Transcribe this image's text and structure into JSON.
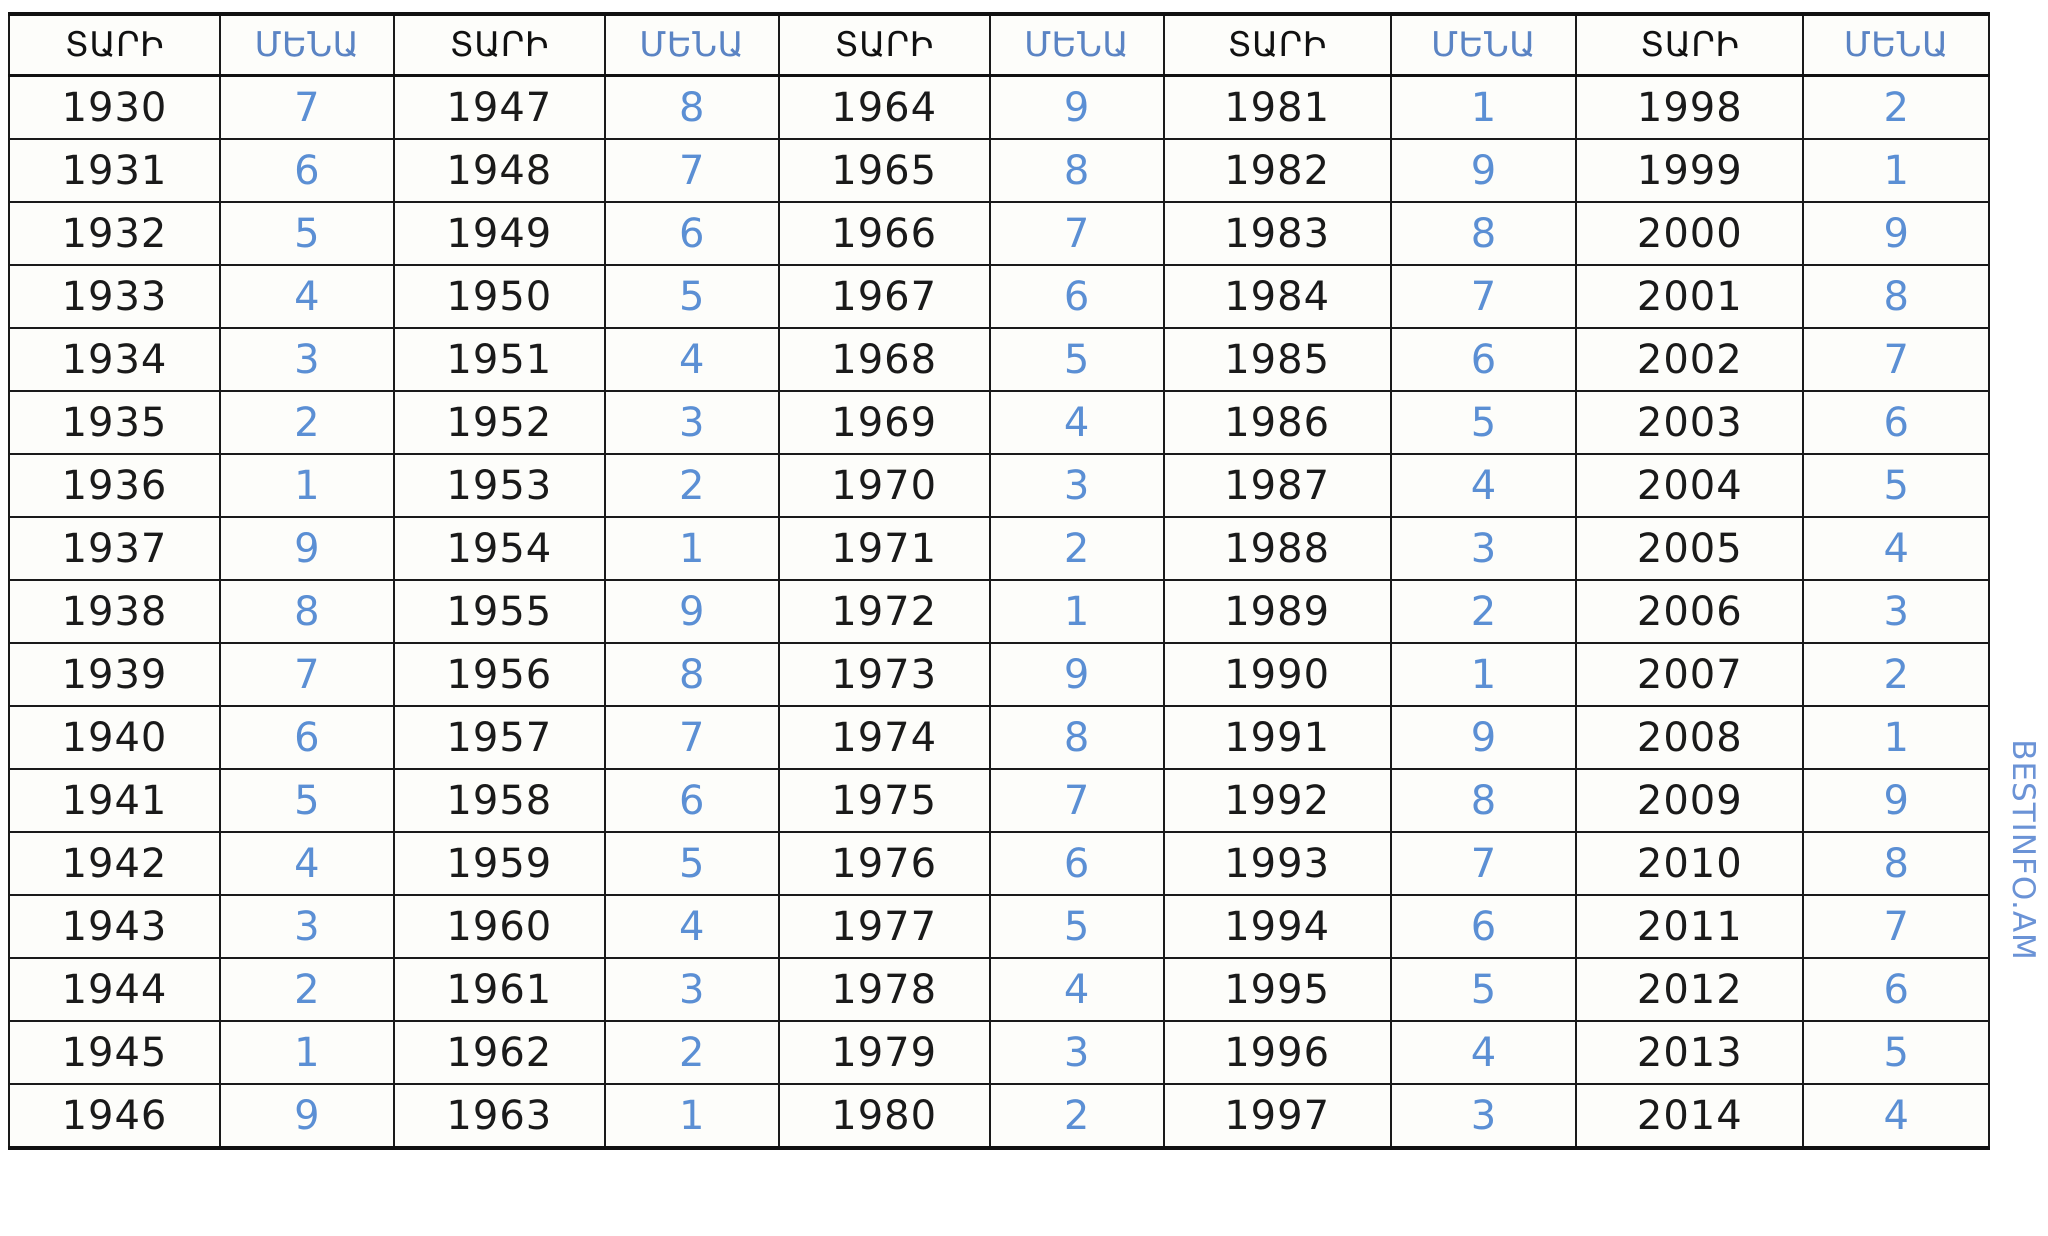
{
  "table": {
    "headers": {
      "year": "ՏԱՐԻ",
      "value": "ՄԵՆԱ"
    },
    "column_headers": [
      "ՏԱՐԻ",
      "ՄԵՆԱ",
      "ՏԱՐԻ",
      "ՄԵՆԱ",
      "ՏԱՐԻ",
      "ՄԵՆԱ",
      "ՏԱՐԻ",
      "ՄԵՆԱ",
      "ՏԱՐԻ",
      "ՄԵՆԱ"
    ],
    "colors": {
      "year_text": "#1a1a1a",
      "value_text": "#5b8fd4",
      "header_value_text": "#5b84c4",
      "border": "#1a1a1a",
      "background": "#fdfdfa"
    },
    "rows": [
      [
        "1930",
        "7",
        "1947",
        "8",
        "1964",
        "9",
        "1981",
        "1",
        "1998",
        "2"
      ],
      [
        "1931",
        "6",
        "1948",
        "7",
        "1965",
        "8",
        "1982",
        "9",
        "1999",
        "1"
      ],
      [
        "1932",
        "5",
        "1949",
        "6",
        "1966",
        "7",
        "1983",
        "8",
        "2000",
        "9"
      ],
      [
        "1933",
        "4",
        "1950",
        "5",
        "1967",
        "6",
        "1984",
        "7",
        "2001",
        "8"
      ],
      [
        "1934",
        "3",
        "1951",
        "4",
        "1968",
        "5",
        "1985",
        "6",
        "2002",
        "7"
      ],
      [
        "1935",
        "2",
        "1952",
        "3",
        "1969",
        "4",
        "1986",
        "5",
        "2003",
        "6"
      ],
      [
        "1936",
        "1",
        "1953",
        "2",
        "1970",
        "3",
        "1987",
        "4",
        "2004",
        "5"
      ],
      [
        "1937",
        "9",
        "1954",
        "1",
        "1971",
        "2",
        "1988",
        "3",
        "2005",
        "4"
      ],
      [
        "1938",
        "8",
        "1955",
        "9",
        "1972",
        "1",
        "1989",
        "2",
        "2006",
        "3"
      ],
      [
        "1939",
        "7",
        "1956",
        "8",
        "1973",
        "9",
        "1990",
        "1",
        "2007",
        "2"
      ],
      [
        "1940",
        "6",
        "1957",
        "7",
        "1974",
        "8",
        "1991",
        "9",
        "2008",
        "1"
      ],
      [
        "1941",
        "5",
        "1958",
        "6",
        "1975",
        "7",
        "1992",
        "8",
        "2009",
        "9"
      ],
      [
        "1942",
        "4",
        "1959",
        "5",
        "1976",
        "6",
        "1993",
        "7",
        "2010",
        "8"
      ],
      [
        "1943",
        "3",
        "1960",
        "4",
        "1977",
        "5",
        "1994",
        "6",
        "2011",
        "7"
      ],
      [
        "1944",
        "2",
        "1961",
        "3",
        "1978",
        "4",
        "1995",
        "5",
        "2012",
        "6"
      ],
      [
        "1945",
        "1",
        "1962",
        "2",
        "1979",
        "3",
        "1996",
        "4",
        "2013",
        "5"
      ],
      [
        "1946",
        "9",
        "1963",
        "1",
        "1980",
        "2",
        "1997",
        "3",
        "2014",
        "4"
      ]
    ]
  },
  "watermark": {
    "text": "BESTINFO.AM",
    "color": "#6b93d6"
  }
}
